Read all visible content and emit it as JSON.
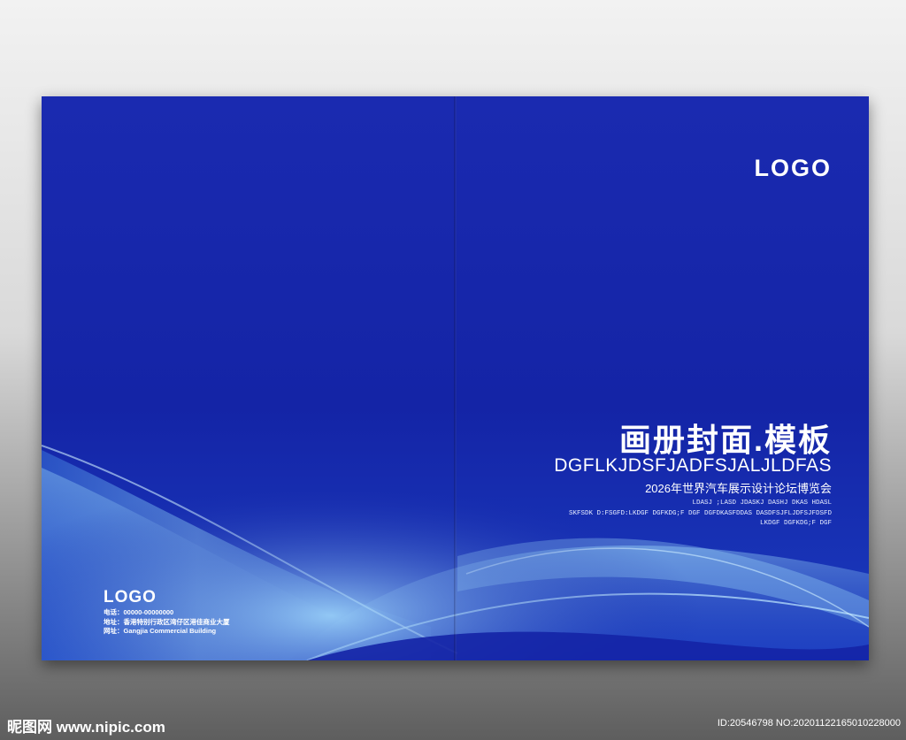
{
  "front": {
    "logo": "LOGO",
    "title": "画册封面.模板",
    "subtitle_en": "DGFLKJDSFJADFSJALJLDFAS",
    "subtitle_cn": "2026年世界汽车展示设计论坛博览会",
    "small_lines": [
      "LDASJ ;LASD JDASKJ DASHJ DKAS HDASL",
      "SKFSDK D:FSGFD:LKDGF DGFKDG;F  DGF DGFDKASFDDAS DASDFSJFLJDFSJFDSFD",
      "LKDGF DGFKDG;F  DGF"
    ]
  },
  "back": {
    "logo": "LOGO",
    "contact": [
      "电话：00000-00000000",
      "地址：香港特别行政区湾仔区港佳商业大厦",
      "网址：Gangjia Commercial Building"
    ]
  },
  "watermark": {
    "site": "昵图网 www.nipic.com",
    "id": "ID:20546798 NO:20201122165010228000"
  },
  "colors": {
    "cover_blue": "#1420a8",
    "wave_light": "#8fd0f5"
  }
}
